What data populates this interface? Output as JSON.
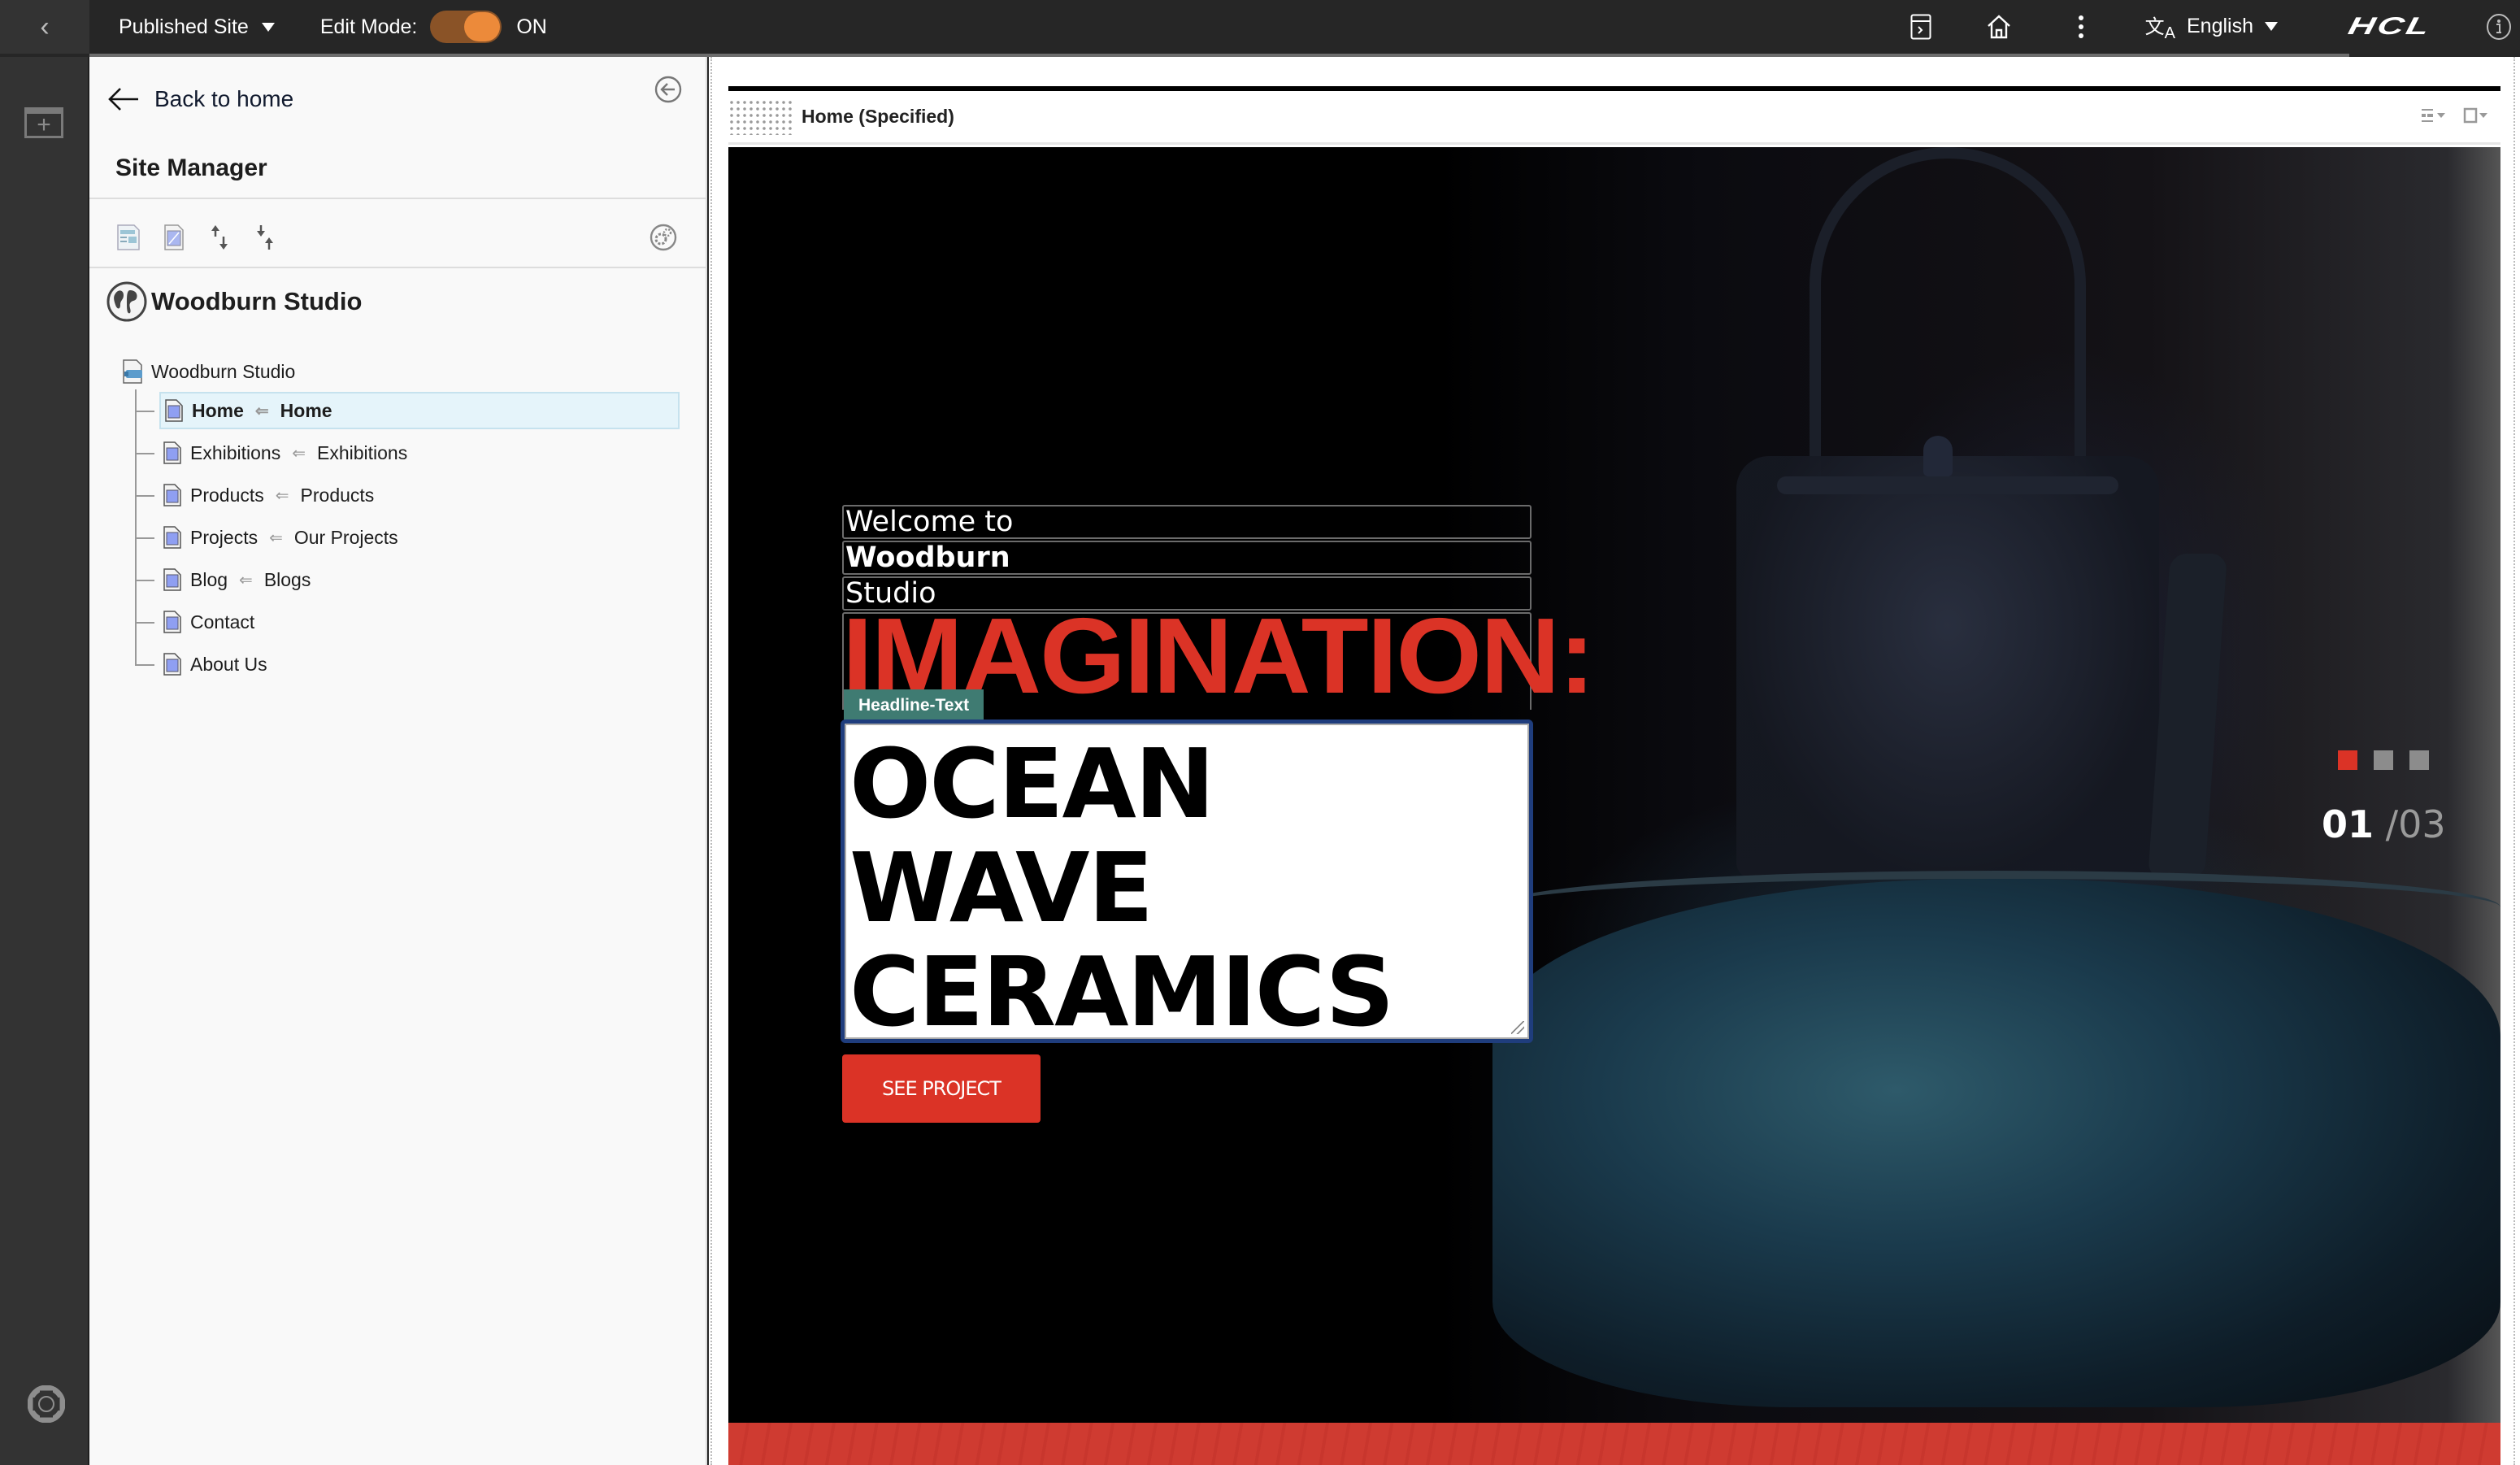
{
  "topbar": {
    "site_select": "Published Site",
    "edit_mode_label": "Edit Mode:",
    "edit_mode_state": "ON",
    "edit_mode_on": true,
    "language": "English",
    "brand": "HCL"
  },
  "panel": {
    "back_link": "Back to home",
    "title": "Site Manager",
    "site_name": "Woodburn Studio",
    "tree": {
      "root": "Woodburn Studio",
      "items": [
        {
          "label": "Home",
          "target": "Home",
          "selected": true
        },
        {
          "label": "Exhibitions",
          "target": "Exhibitions",
          "selected": false
        },
        {
          "label": "Products",
          "target": "Products",
          "selected": false
        },
        {
          "label": "Projects",
          "target": "Our Projects",
          "selected": false
        },
        {
          "label": "Blog",
          "target": "Blogs",
          "selected": false
        },
        {
          "label": "Contact",
          "target": "",
          "selected": false
        },
        {
          "label": "About Us",
          "target": "",
          "selected": false
        }
      ]
    }
  },
  "main": {
    "page_title": "Home (Specified)",
    "hero": {
      "welcome": "Welcome to",
      "studio_bold": "Woodburn",
      "studio": "Studio",
      "imagination": "IMAGINATION:",
      "tag": "Headline-Text",
      "headline": "OCEAN\nWAVE\nCERAMICS",
      "button": "SEE PROJECT",
      "slide_current": "01",
      "slide_separator": "/",
      "slide_total": "03",
      "slides": 3,
      "active_slide": 1
    }
  },
  "colors": {
    "accent_red": "#db3326",
    "toggle_on": "#ec8a3a",
    "tag_teal": "#3f7b72",
    "selection_blue": "#1f3d7d"
  }
}
